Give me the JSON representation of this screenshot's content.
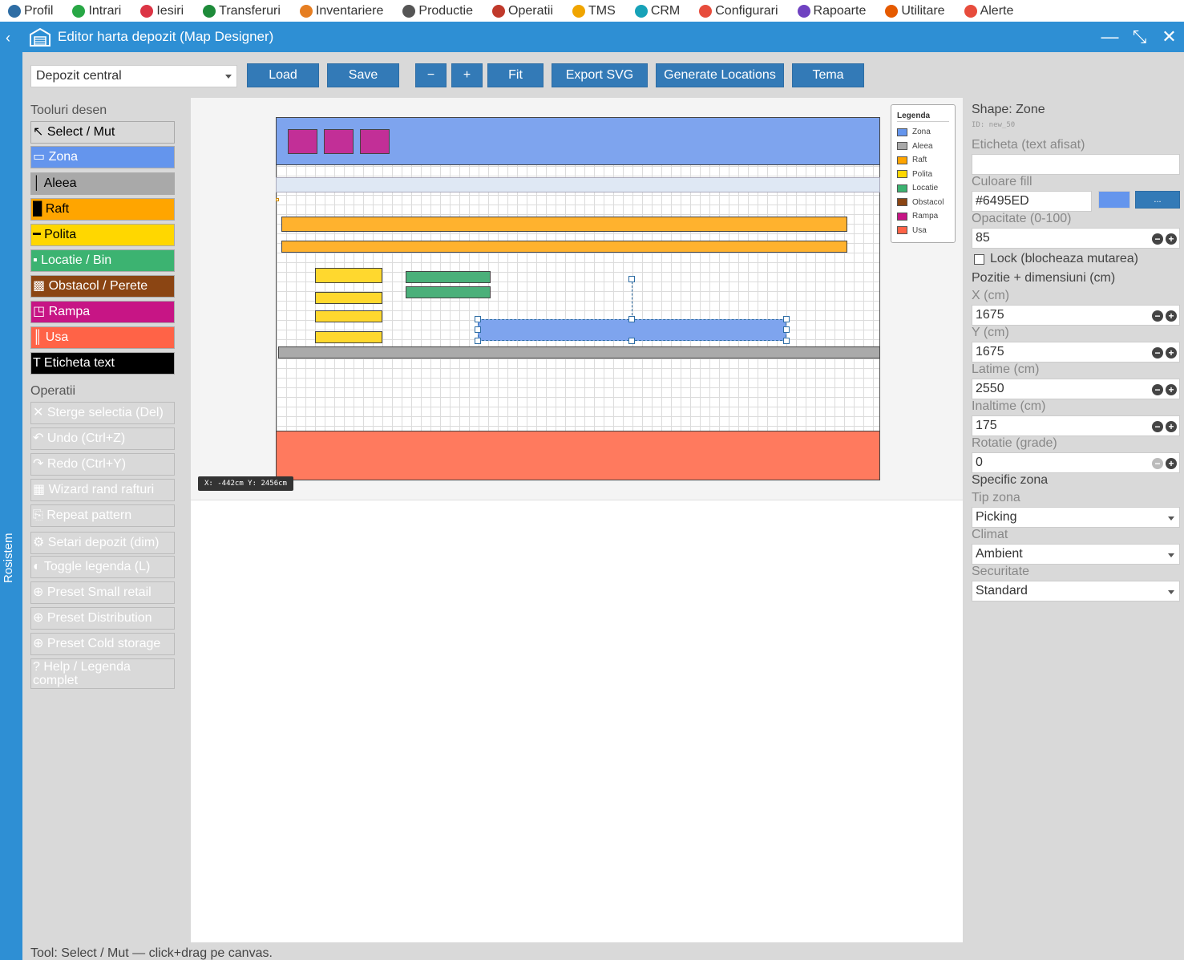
{
  "top_menu": [
    {
      "label": "Profil",
      "icon": "user-icon",
      "color": "#2e6da4"
    },
    {
      "label": "Intrari",
      "icon": "plus-circle-icon",
      "color": "#28a745"
    },
    {
      "label": "Iesiri",
      "icon": "minus-circle-icon",
      "color": "#dc3545"
    },
    {
      "label": "Transferuri",
      "icon": "transfer-icon",
      "color": "#1e8b3a"
    },
    {
      "label": "Inventariere",
      "icon": "inventory-icon",
      "color": "#e67e22"
    },
    {
      "label": "Productie",
      "icon": "production-icon",
      "color": "#555555"
    },
    {
      "label": "Operatii",
      "icon": "operations-icon",
      "color": "#c0392b"
    },
    {
      "label": "TMS",
      "icon": "truck-icon",
      "color": "#f0a500"
    },
    {
      "label": "CRM",
      "icon": "info-icon",
      "color": "#17a2b8"
    },
    {
      "label": "Configurari",
      "icon": "config-icon",
      "color": "#e74c3c"
    },
    {
      "label": "Rapoarte",
      "icon": "report-icon",
      "color": "#6f42c1"
    },
    {
      "label": "Utilitare",
      "icon": "gear-icon",
      "color": "#e55a00"
    },
    {
      "label": "Alerte",
      "icon": "bell-icon",
      "color": "#e74c3c"
    }
  ],
  "side_strip": {
    "label": "Rosistem"
  },
  "window": {
    "title": "Editor harta depozit (Map Designer)"
  },
  "toolbar": {
    "warehouse_select": "Depozit central",
    "load": "Load",
    "save": "Save",
    "zoom_out": "−",
    "zoom_in": "+",
    "fit": "Fit",
    "export_svg": "Export SVG",
    "generate_locations": "Generate Locations",
    "theme": "Tema"
  },
  "tools": {
    "heading": "Tooluri desen",
    "items": [
      {
        "label": "↖ Select / Mut",
        "bg": "#d9d9d9",
        "fg": "#000000"
      },
      {
        "label": "▭ Zona",
        "bg": "#6495ED",
        "fg": "#ffffff"
      },
      {
        "label": "│ Aleea",
        "bg": "#a9a9a9",
        "fg": "#000000"
      },
      {
        "label": "█  Raft",
        "bg": "#FFA500",
        "fg": "#000000"
      },
      {
        "label": "━ Polita",
        "bg": "#FFD700",
        "fg": "#000000"
      },
      {
        "label": "▪ Locatie / Bin",
        "bg": "#3CB371",
        "fg": "#ffffff"
      },
      {
        "label": "▩ Obstacol / Perete",
        "bg": "#8B4513",
        "fg": "#ffffff"
      },
      {
        "label": "◳ Rampa",
        "bg": "#C71585",
        "fg": "#ffffff"
      },
      {
        "label": "║ Usa",
        "bg": "#FF6347",
        "fg": "#ffffff"
      },
      {
        "label": "T Eticheta text",
        "bg": "#000000",
        "fg": "#ffffff"
      }
    ]
  },
  "operations": {
    "heading": "Operatii",
    "items": [
      "✕ Sterge selectia (Del)",
      "↶ Undo (Ctrl+Z)",
      "↷ Redo (Ctrl+Y)",
      "▦ Wizard rand rafturi",
      "⎘ Repeat pattern",
      "⚙ Setari depozit (dim)",
      "◐ Toggle legenda (L)",
      "⊕ Preset Small retail",
      "⊕ Preset Distribution",
      "⊕ Preset Cold storage",
      "? Help / Legenda complet"
    ]
  },
  "canvas": {
    "coords": "X: -442cm Y: 2456cm"
  },
  "legend": {
    "title": "Legenda",
    "items": [
      {
        "label": "Zona",
        "color": "#6495ED"
      },
      {
        "label": "Aleea",
        "color": "#a9a9a9"
      },
      {
        "label": "Raft",
        "color": "#FFA500"
      },
      {
        "label": "Polita",
        "color": "#FFD700"
      },
      {
        "label": "Locatie",
        "color": "#3CB371"
      },
      {
        "label": "Obstacol",
        "color": "#8B4513"
      },
      {
        "label": "Rampa",
        "color": "#C71585"
      },
      {
        "label": "Usa",
        "color": "#FF6347"
      }
    ]
  },
  "properties": {
    "shape_title": "Shape: Zone",
    "shape_id": "ID: new_50",
    "label_caption": "Eticheta (text afisat)",
    "label_value": "",
    "fill_caption": "Culoare fill",
    "fill_value": "#6495ED",
    "fill_more": "...",
    "opacity_caption": "Opacitate (0-100)",
    "opacity_value": "85",
    "lock_label": "Lock (blocheaza mutarea)",
    "pos_header": "Pozitie + dimensiuni (cm)",
    "x_caption": "X (cm)",
    "x_value": "1675",
    "y_caption": "Y (cm)",
    "y_value": "1675",
    "w_caption": "Latime (cm)",
    "w_value": "2550",
    "h_caption": "Inaltime (cm)",
    "h_value": "175",
    "rot_caption": "Rotatie (grade)",
    "rot_value": "0",
    "zone_header": "Specific zona",
    "type_caption": "Tip zona",
    "type_value": "Picking",
    "climate_caption": "Climat",
    "climate_value": "Ambient",
    "security_caption": "Securitate",
    "security_value": "Standard"
  },
  "status_bar": "Tool: Select / Mut — click+drag pe canvas."
}
